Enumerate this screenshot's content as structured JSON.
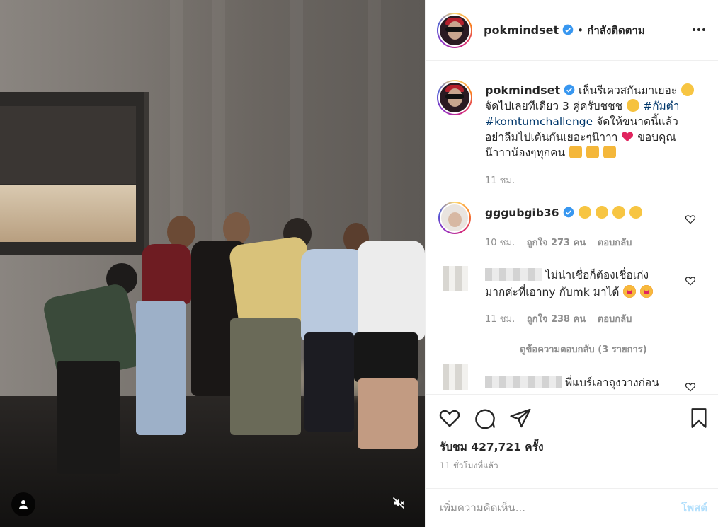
{
  "post": {
    "author": "pokmindset",
    "separator": "•",
    "follow_status": "กำลังติดตาม"
  },
  "caption": {
    "username": "pokmindset",
    "text_1": "เห็นรีเควสกันมาเยอะ",
    "text_2": "จัดไปเลยทีเดียว 3 คู่ครับชชช",
    "hashtag_1": "#กัมต๋า",
    "hashtag_2": "#komtumchallenge",
    "text_3": "จัดให้ขนาดนี้แล้ว",
    "text_4": "อย่าลืมไปเต้นกันเยอะๆน๊าาา",
    "text_5": "ขอบคุณ",
    "text_6": "น๊าาาน้องๆทุกคน",
    "time": "11 ชม."
  },
  "comments": [
    {
      "username": "gggubgib36",
      "time": "10 ชม.",
      "likes": "ถูกใจ 273 คน",
      "reply": "ตอบกลับ"
    },
    {
      "text_1": "ไม่น่าเชื่อก็ต้องเชื่อเก่ง",
      "text_2": "มากค่ะที่เอาny กับmk มาได้",
      "time": "11 ชม.",
      "likes": "ถูกใจ 238 คน",
      "reply": "ตอบกลับ",
      "view_replies": "ดูข้อความตอบกลับ (3 รายการ)"
    },
    {
      "text_1": "พี่แบร์เอาถุงวางก่อน"
    }
  ],
  "actions": {
    "views": "รับชม 427,721 ครั้ง",
    "time_ago": "11 ชั่วโมงที่แล้ว"
  },
  "add_comment": {
    "placeholder": "เพิ่มความคิดเห็น...",
    "post_label": "โพสต์"
  },
  "icons": {
    "verified": "verified-badge-icon",
    "more": "more-options-icon",
    "like": "heart-icon",
    "comment": "comment-icon",
    "share": "share-icon",
    "save": "bookmark-icon",
    "mute": "mute-icon",
    "tag": "user-tag-icon"
  },
  "colors": {
    "verified": "#3897f0",
    "link": "#00376b",
    "meta": "#8e8e8e",
    "post_disabled": "#b2dffc",
    "heart": "#ed4956"
  }
}
